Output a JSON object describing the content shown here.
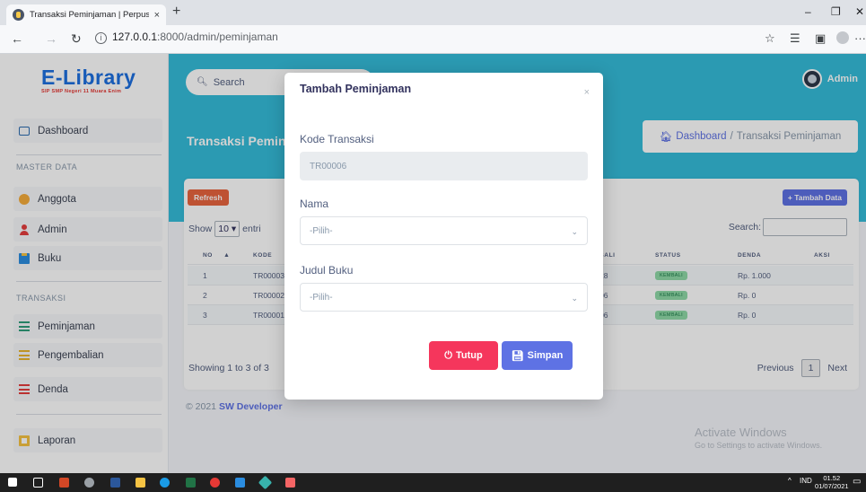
{
  "browser": {
    "tab_title": "Transaksi Peminjaman | Perpusta",
    "tab_close": "×",
    "new_tab": "+",
    "url_host": "127.0.0.1",
    "url_path": ":8000/admin/peminjaman",
    "minimize": "–",
    "restore": "❐",
    "close": "✕",
    "more": "···"
  },
  "sidebar": {
    "logo": "E-Library",
    "logo_sub": "SIP SMP Negeri 11 Muara Enim",
    "dashboard": "Dashboard",
    "master_head": "MASTER DATA",
    "items_master": [
      "Anggota",
      "Admin",
      "Buku"
    ],
    "transaksi_head": "TRANSAKSI",
    "items_transaksi": [
      "Peminjaman",
      "Pengembalian",
      "Denda"
    ],
    "laporan": "Laporan"
  },
  "topbar": {
    "search_placeholder": "Search",
    "user": "Admin"
  },
  "page": {
    "title": "Transaksi Pemin",
    "breadcrumb_home": "Dashboard",
    "breadcrumb_sep": "/",
    "breadcrumb_current": "Transaksi Peminjaman"
  },
  "table": {
    "refresh": "Refresh",
    "add": "+ Tambah Data",
    "show": "Show",
    "entries_value": "10",
    "entries_suffix": "entri",
    "search_label": "Search:",
    "headers": [
      "NO",
      "KODE",
      "BALI",
      "STATUS",
      "DENDA",
      "AKSI"
    ],
    "rows": [
      {
        "no": "1",
        "kode": "TR00003",
        "kembali": "28",
        "status": "KEMBALI",
        "denda": "Rp. 1.000"
      },
      {
        "no": "2",
        "kode": "TR00002",
        "kembali": "06",
        "status": "KEMBALI",
        "denda": "Rp. 0"
      },
      {
        "no": "3",
        "kode": "TR00001",
        "kembali": "06",
        "status": "KEMBALI",
        "denda": "Rp. 0"
      }
    ],
    "showing": "Showing 1 to 3 of 3",
    "previous": "Previous",
    "page": "1",
    "next": "Next"
  },
  "footer": {
    "prefix": "© 2021",
    "brand": "SW Developer"
  },
  "watermark": {
    "line1": "Activate Windows",
    "line2": "Go to Settings to activate Windows."
  },
  "modal": {
    "title": "Tambah Peminjaman",
    "close": "×",
    "kode_label": "Kode Transaksi",
    "kode_value": "TR00006",
    "nama_label": "Nama",
    "nama_placeholder": "-Pilih-",
    "judul_label": "Judul Buku",
    "judul_placeholder": "-Pilih-",
    "btn_tutup": "Tutup",
    "btn_simpan": "Simpan"
  },
  "taskbar": {
    "lang": "IND",
    "time": "01.52",
    "date": "01/07/2021"
  },
  "colors": {
    "primary": "#5e72e4",
    "header": "#35bcd9",
    "danger": "#f5365c",
    "refresh": "#e8643f"
  }
}
